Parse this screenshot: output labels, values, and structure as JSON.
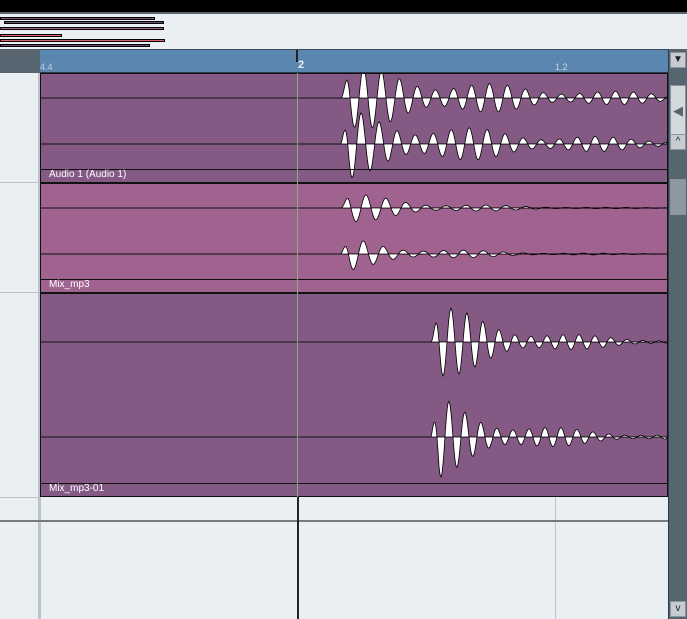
{
  "ruler": {
    "labels": [
      "4.4",
      "2",
      "1.2"
    ]
  },
  "tracks": [
    {
      "name": "Audio 1 (Audio 1)",
      "color": "#845a85"
    },
    {
      "name": "Mix_mp3",
      "color": "#a0628f"
    },
    {
      "name": "Mix_mp3-01",
      "color": "#845a85"
    }
  ],
  "scrollbar": {
    "up_icon": "caret-up-icon",
    "down_icon": "caret-down-icon",
    "zoom_icon": "triangle-left-icon"
  },
  "colors": {
    "ruler": "#5a86b0",
    "background": "#e9eff3",
    "cursor": "#7ab37a"
  }
}
